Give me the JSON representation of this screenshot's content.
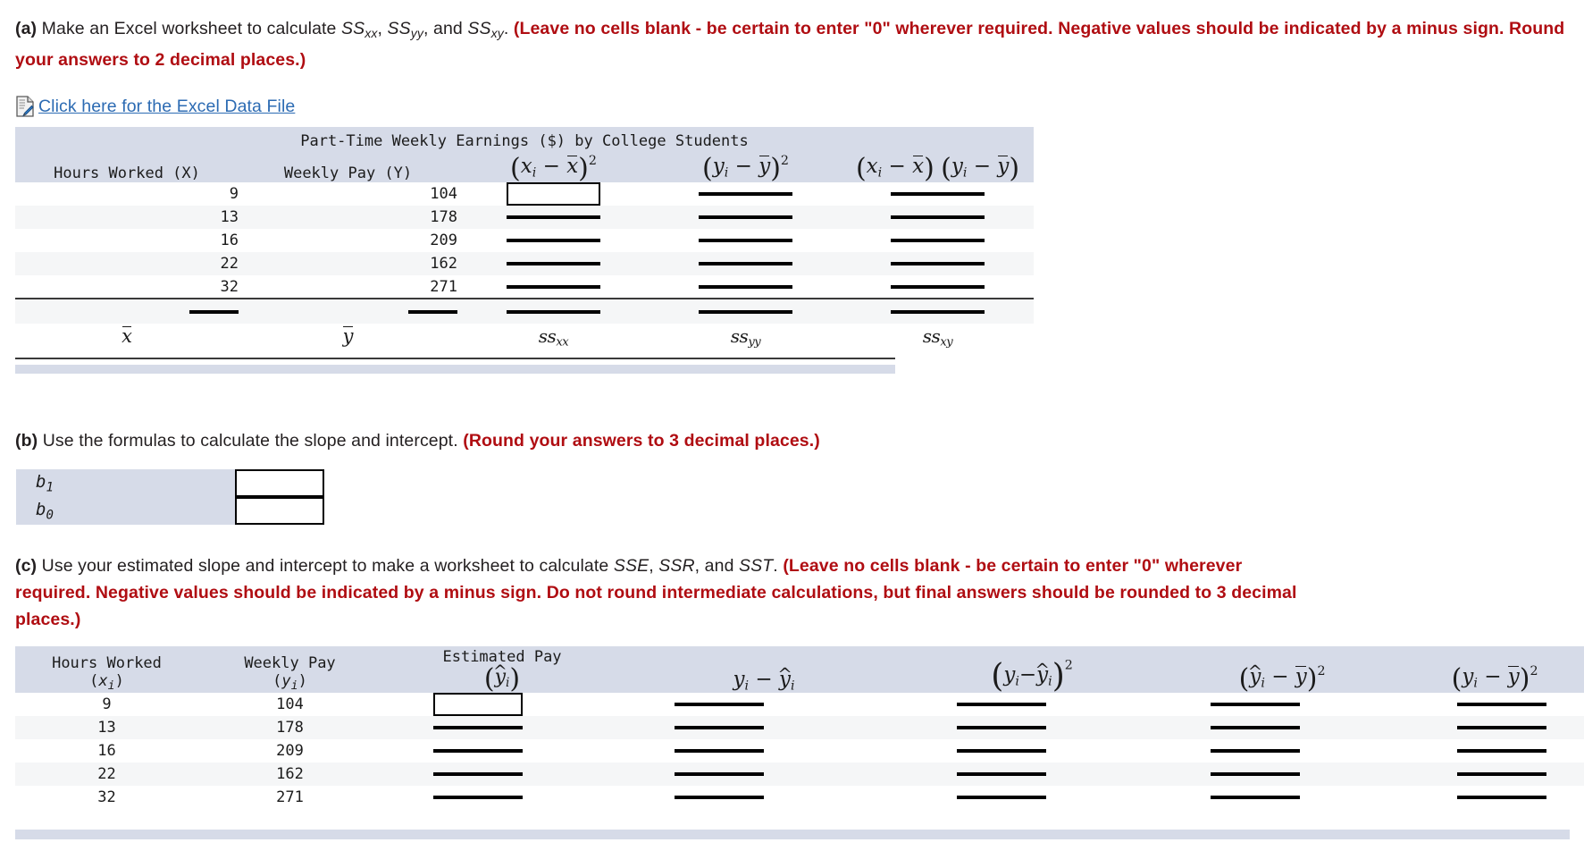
{
  "part_a": {
    "label": "(a)",
    "text_plain_1": " Make an Excel worksheet to calculate ",
    "m1": "SS",
    "m1sub": "xx",
    "text_plain_2": ", ",
    "m2": "SS",
    "m2sub": "yy",
    "text_plain_3": ", and ",
    "m3": "SS",
    "m3sub": "xy",
    "text_plain_4": ". ",
    "red": "(Leave no cells blank - be certain to enter \"0\" wherever required. Negative values should be indicated by a minus sign. Round your answers to 2 decimal places.)"
  },
  "excel_link": {
    "icon": "excel-document-icon",
    "label": "Click here for the Excel Data File",
    "color": "#2c6bb3"
  },
  "table_a": {
    "title": "Part-Time Weekly Earnings ($) by College Students",
    "headers": [
      "Hours Worked (X)",
      "Weekly Pay (Y)",
      "(xi − x̄)²",
      "(yi − ȳ)²",
      "(xi − x̄)(yi − ȳ)"
    ],
    "rows": [
      {
        "hours": "9",
        "pay": "104"
      },
      {
        "hours": "13",
        "pay": "178"
      },
      {
        "hours": "16",
        "pay": "209"
      },
      {
        "hours": "22",
        "pay": "162"
      },
      {
        "hours": "32",
        "pay": "271"
      }
    ],
    "footer_labels": [
      "x̄",
      "ȳ",
      "SSxx",
      "SSyy",
      "SSxy"
    ],
    "input_value": "",
    "header_bg": "#d6dbe8",
    "stripe_bg": "#f5f6f7"
  },
  "part_b": {
    "label": "(b)",
    "text_plain": " Use the formulas to calculate the slope and intercept. ",
    "red": "(Round your answers to 3 decimal places.)"
  },
  "table_b": {
    "rows": [
      {
        "label": "b",
        "sub": "1",
        "value": ""
      },
      {
        "label": "b",
        "sub": "0",
        "value": ""
      }
    ],
    "bg": "#d6dbe8"
  },
  "part_c": {
    "label": "(c)",
    "text_plain_1": " Use your estimated slope and intercept to make a worksheet to calculate ",
    "m1": "SSE",
    "text_plain_2": ", ",
    "m2": "SSR",
    "text_plain_3": ", and ",
    "m3": "SST",
    "text_plain_4": ". ",
    "red": "(Leave no cells blank - be certain to enter \"0\" wherever required. Negative values should be indicated by a minus sign. Do not round intermediate calculations, but final answers should be rounded to 3 decimal places.)"
  },
  "table_c": {
    "headers": [
      {
        "line1": "Hours Worked",
        "line2": "(xi)"
      },
      {
        "line1": "Weekly Pay",
        "line2": "(yi)"
      },
      {
        "line1": "Estimated Pay",
        "line2": "(ŷi)"
      },
      {
        "line1": "",
        "line2": "yi − ŷi"
      },
      {
        "line1": "",
        "line2": "(yi−ŷi)²"
      },
      {
        "line1": "",
        "line2": "(ŷi − ȳ)²"
      },
      {
        "line1": "",
        "line2": "(yi − ȳ)²"
      }
    ],
    "rows": [
      {
        "hours": "9",
        "pay": "104"
      },
      {
        "hours": "13",
        "pay": "178"
      },
      {
        "hours": "16",
        "pay": "209"
      },
      {
        "hours": "22",
        "pay": "162"
      },
      {
        "hours": "32",
        "pay": "271"
      }
    ],
    "input_value": "",
    "header_bg": "#d6dbe8",
    "stripe_bg": "#f5f6f7"
  }
}
